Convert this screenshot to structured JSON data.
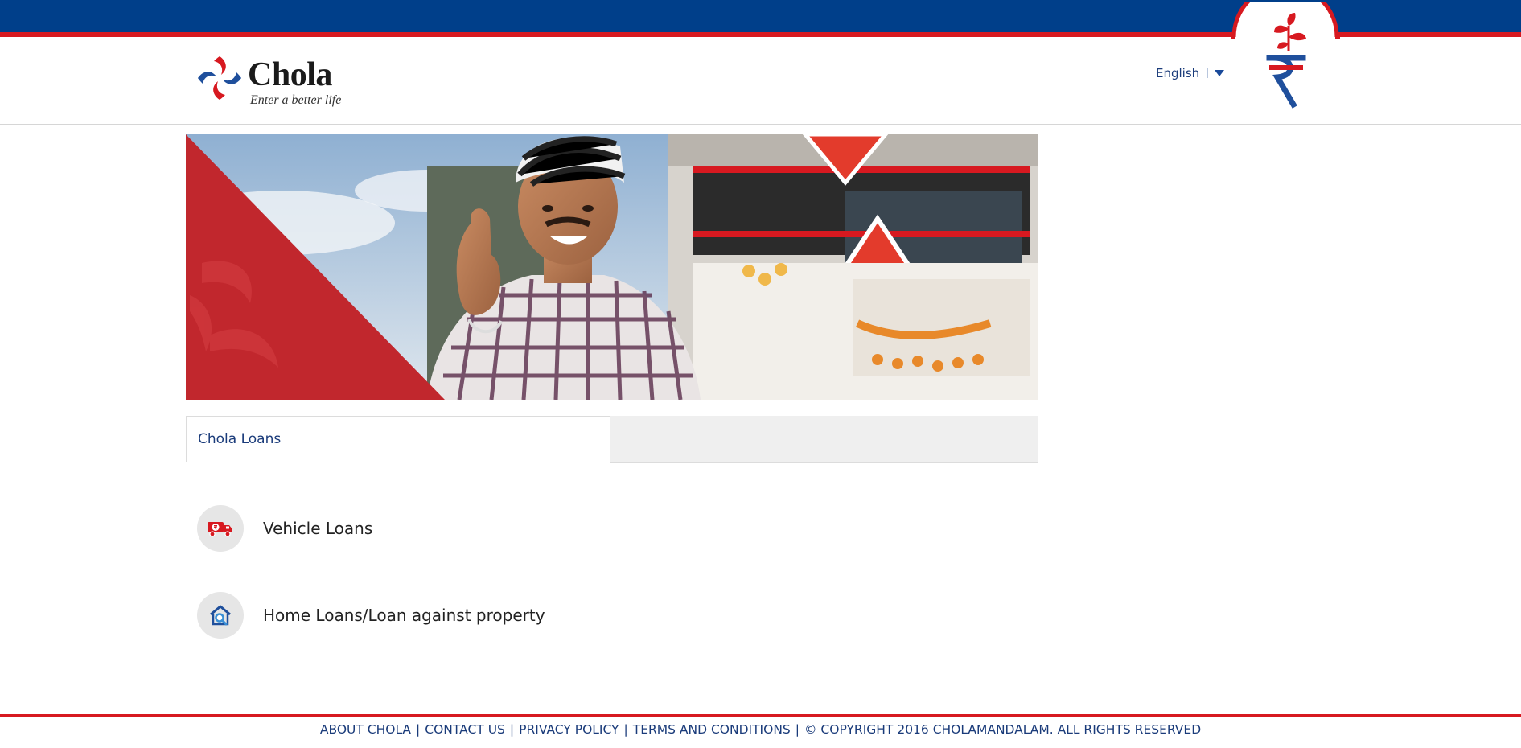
{
  "brand": {
    "name": "Chola",
    "tagline": "Enter a better life",
    "colors": {
      "navy": "#003f8a",
      "red": "#d71920"
    }
  },
  "header": {
    "language": "English",
    "emblem_icon": "rupee-plant-icon"
  },
  "hero": {
    "image": "man-thumbs-up-with-truck"
  },
  "tabs": [
    {
      "label": "Chola Loans",
      "active": true
    }
  ],
  "loans": [
    {
      "label": "Vehicle Loans",
      "icon": "truck-rupee-icon"
    },
    {
      "label": "Home Loans/Loan against property",
      "icon": "home-search-icon"
    }
  ],
  "footer": {
    "links": [
      "ABOUT CHOLA",
      "CONTACT US",
      "PRIVACY POLICY",
      "TERMS AND CONDITIONS"
    ],
    "copyright": "© COPYRIGHT 2016 CHOLAMANDALAM. ALL RIGHTS RESERVED"
  }
}
